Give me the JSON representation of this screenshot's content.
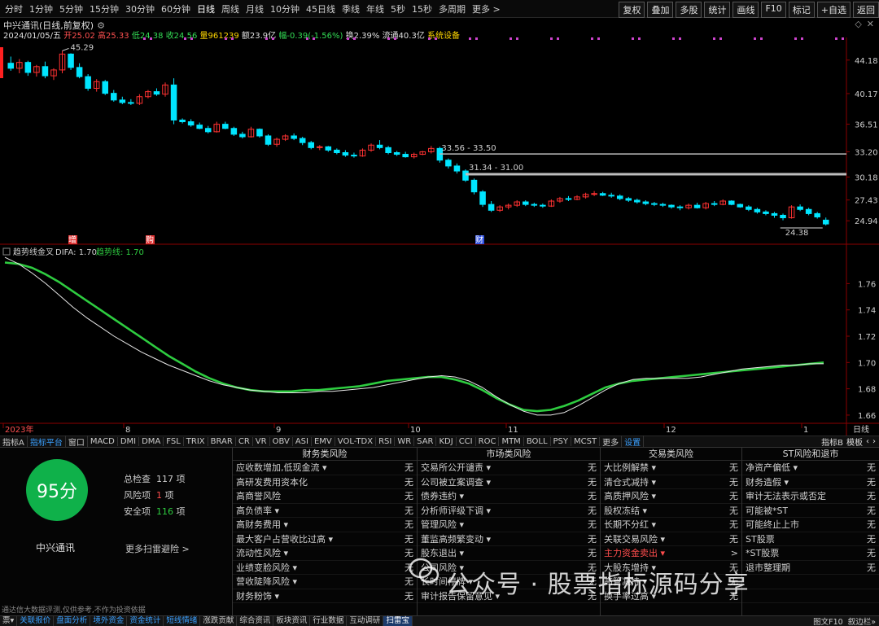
{
  "periods": [
    "分时",
    "1分钟",
    "5分钟",
    "15分钟",
    "30分钟",
    "60分钟",
    "日线",
    "周线",
    "月线",
    "10分钟",
    "45日线",
    "季线",
    "年线",
    "5秒",
    "15秒",
    "多周期",
    "更多 >"
  ],
  "active_period": "日线",
  "right_buttons": [
    "复权",
    "叠加",
    "多股",
    "统计",
    "画线",
    "F10",
    "标记",
    "+自选",
    "返回"
  ],
  "chart_title": "中兴通讯(日线,前复权)",
  "info": {
    "date": "2024/01/05/五",
    "open": "开25.02",
    "high": "高25.33",
    "low": "低24.38",
    "close": "收24.56",
    "volume": "量961239",
    "amount": "额23.9亿",
    "change": "幅-0.39(-1.56%)",
    "turnover": "换2.39%",
    "float": "流通40.3亿",
    "settings": "系统设备"
  },
  "window_controls": [
    "◇",
    "✕"
  ],
  "price_axis": [
    "44.18",
    "40.17",
    "36.51",
    "33.20",
    "30.18",
    "27.43",
    "24.94"
  ],
  "indicator_axis": [
    "1.76",
    "1.74",
    "1.72",
    "1.70",
    "1.68",
    "1.66"
  ],
  "date_labels": [
    "2023年",
    "8",
    "9",
    "10",
    "11",
    "12",
    "1"
  ],
  "date_right": "日线",
  "annotations": {
    "high": "45.29",
    "low": "24.38",
    "level1": "33.56 - 33.50",
    "level2": "31.34 - 31.00",
    "marker_a": "增",
    "marker_b": "购",
    "marker_c": "财"
  },
  "indicator": {
    "name": "趋势线金叉",
    "difa": "DIFA: 1.70",
    "trend": "趋势线: 1.70"
  },
  "indicator_tabs": [
    "指标A",
    "指标平台",
    "窗口",
    "MACD",
    "DMI",
    "DMA",
    "FSL",
    "TRIX",
    "BRAR",
    "CR",
    "VR",
    "OBV",
    "ASI",
    "EMV",
    "VOL-TDX",
    "RSI",
    "WR",
    "SAR",
    "KDJ",
    "CCI",
    "ROC",
    "MTM",
    "BOLL",
    "PSY",
    "MCST",
    "更多",
    "设置"
  ],
  "indicator_tabs_right": [
    "指标B",
    "模板",
    "‹",
    "›"
  ],
  "score": {
    "value": "95分",
    "company": "中兴通讯",
    "total_label": "总检查",
    "total": "117",
    "risk_label": "风险项",
    "risk": "1",
    "safe_label": "安全项",
    "safe": "116",
    "unit": "项",
    "more": "更多扫雷避险 >",
    "disclaimer": "通达信大数据评测,仅供参考,不作为投资依据"
  },
  "columns": [
    {
      "title": "财务类风险",
      "rows": [
        {
          "name": "应收数增加,低现金流 ▾",
          "value": "无"
        },
        {
          "name": "高研发费用资本化",
          "value": "无"
        },
        {
          "name": "高商誉风险",
          "value": "无"
        },
        {
          "name": "高负债率 ▾",
          "value": "无"
        },
        {
          "name": "高财务费用 ▾",
          "value": "无"
        },
        {
          "name": "最大客户占营收比过高 ▾",
          "value": "无"
        },
        {
          "name": "流动性风险 ▾",
          "value": "无"
        },
        {
          "name": "业绩变脸风险 ▾",
          "value": "无"
        },
        {
          "name": "营收陡降风险 ▾",
          "value": "无"
        },
        {
          "name": "财务粉饰 ▾",
          "value": "无"
        }
      ]
    },
    {
      "title": "市场类风险",
      "rows": [
        {
          "name": "交易所公开谴责 ▾",
          "value": "无"
        },
        {
          "name": "公司被立案调查 ▾",
          "value": "无"
        },
        {
          "name": "债券违约 ▾",
          "value": "无"
        },
        {
          "name": "分析师评级下调 ▾",
          "value": "无"
        },
        {
          "name": "管理风险 ▾",
          "value": "无"
        },
        {
          "name": "董监高频繁变动 ▾",
          "value": "无"
        },
        {
          "name": "股东退出 ▾",
          "value": "无"
        },
        {
          "name": "公司风险 ▾",
          "value": "无"
        },
        {
          "name": "长时间停牌 ▾",
          "value": "无"
        },
        {
          "name": "审计报告保留意见 ▾",
          "value": "无"
        }
      ]
    },
    {
      "title": "交易类风险",
      "rows": [
        {
          "name": "大比例解禁 ▾",
          "value": "无"
        },
        {
          "name": "清仓式减持 ▾",
          "value": "无"
        },
        {
          "name": "高质押风险 ▾",
          "value": "无"
        },
        {
          "name": "股权冻结 ▾",
          "value": "无"
        },
        {
          "name": "长期不分红 ▾",
          "value": "无"
        },
        {
          "name": "关联交易风险 ▾",
          "value": "无"
        },
        {
          "name": "主力资金卖出 ▾",
          "value": ">",
          "red": true
        },
        {
          "name": "大股东增持 ▾",
          "value": "无"
        },
        {
          "name": "高管减持 ▾",
          "value": "无"
        },
        {
          "name": "换手率过高 ▾",
          "value": "无"
        }
      ]
    },
    {
      "title": "ST风险和退市",
      "rows": [
        {
          "name": "净资产偏低 ▾",
          "value": "无"
        },
        {
          "name": "财务造假 ▾",
          "value": "无"
        },
        {
          "name": "审计无法表示或否定",
          "value": "无"
        },
        {
          "name": "可能被*ST",
          "value": "无"
        },
        {
          "name": "可能终止上市",
          "value": "无"
        },
        {
          "name": "ST股票",
          "value": "无"
        },
        {
          "name": "*ST股票",
          "value": "无"
        },
        {
          "name": "退市整理期",
          "value": "无"
        },
        {
          "name": "",
          "value": ""
        },
        {
          "name": "",
          "value": ""
        }
      ]
    }
  ],
  "watermark": "公众号 · 股票指标源码分享",
  "taskbar": [
    "票▾",
    "关联报价",
    "盘面分析",
    "境外资金",
    "资金统计",
    "短线情绪",
    "涨跌贡献",
    "综合资讯",
    "板块资讯",
    "行业数据",
    "互动调研",
    "扫雷宝"
  ],
  "taskbar_selected": "扫雷宝",
  "taskbar_right": [
    "图文F10",
    "叙边栏»"
  ],
  "colors": {
    "up": "#ff3232",
    "down": "#00e5ff",
    "ma_white": "#e6e6e6",
    "trend_green": "#2ecc40",
    "score_green": "#0fb14a",
    "purple_marks": "#cc44cc"
  },
  "chart_data": {
    "type": "candlestick",
    "ylim": [
      23.5,
      46.5
    ],
    "candles": [
      [
        43.8,
        44.6,
        42.9,
        43.2
      ],
      [
        43.2,
        44.3,
        42.6,
        43.9
      ],
      [
        43.9,
        44.1,
        42.3,
        42.7
      ],
      [
        42.7,
        43.6,
        42.2,
        43.4
      ],
      [
        43.4,
        44.0,
        42.0,
        42.3
      ],
      [
        42.3,
        43.2,
        41.8,
        43.0
      ],
      [
        43.0,
        45.29,
        42.6,
        44.9
      ],
      [
        44.9,
        45.0,
        43.0,
        43.3
      ],
      [
        43.3,
        43.8,
        42.0,
        42.2
      ],
      [
        42.2,
        42.5,
        40.5,
        40.8
      ],
      [
        40.8,
        41.9,
        40.4,
        41.6
      ],
      [
        41.6,
        41.8,
        40.0,
        40.2
      ],
      [
        40.2,
        40.6,
        39.2,
        39.4
      ],
      [
        39.4,
        39.8,
        38.9,
        39.1
      ],
      [
        39.1,
        39.5,
        38.8,
        39.0
      ],
      [
        39.0,
        40.1,
        38.8,
        39.8
      ],
      [
        39.8,
        40.6,
        39.6,
        40.4
      ],
      [
        40.4,
        40.8,
        39.9,
        40.1
      ],
      [
        40.1,
        41.5,
        39.8,
        41.2
      ],
      [
        41.2,
        42.0,
        36.5,
        37.0
      ],
      [
        37.0,
        37.2,
        36.6,
        36.8
      ],
      [
        36.8,
        37.1,
        36.2,
        36.4
      ],
      [
        36.4,
        36.7,
        35.9,
        36.0
      ],
      [
        36.0,
        36.3,
        35.4,
        35.6
      ],
      [
        35.6,
        36.8,
        35.5,
        36.5
      ],
      [
        36.5,
        36.8,
        35.9,
        36.0
      ],
      [
        36.0,
        36.2,
        35.1,
        35.3
      ],
      [
        35.3,
        35.6,
        34.8,
        35.0
      ],
      [
        35.0,
        36.2,
        34.9,
        35.9
      ],
      [
        35.9,
        36.0,
        34.9,
        35.1
      ],
      [
        35.1,
        35.3,
        33.9,
        34.1
      ],
      [
        34.1,
        34.9,
        33.8,
        34.7
      ],
      [
        34.7,
        35.3,
        34.5,
        35.1
      ],
      [
        35.1,
        35.4,
        34.6,
        34.8
      ],
      [
        34.8,
        35.0,
        34.0,
        34.3
      ],
      [
        34.3,
        34.5,
        33.5,
        33.7
      ],
      [
        33.7,
        34.0,
        33.4,
        33.8
      ],
      [
        33.8,
        33.9,
        33.2,
        33.4
      ],
      [
        33.4,
        33.6,
        32.9,
        33.1
      ],
      [
        33.1,
        33.4,
        32.6,
        32.8
      ],
      [
        32.8,
        33.1,
        32.5,
        32.7
      ],
      [
        32.7,
        33.6,
        32.6,
        33.4
      ],
      [
        33.4,
        34.2,
        33.2,
        34.0
      ],
      [
        34.0,
        34.6,
        33.5,
        33.7
      ],
      [
        33.7,
        33.9,
        32.9,
        33.1
      ],
      [
        33.1,
        33.3,
        32.7,
        32.9
      ],
      [
        32.9,
        33.2,
        32.5,
        32.6
      ],
      [
        32.6,
        33.1,
        32.4,
        32.9
      ],
      [
        32.9,
        33.3,
        32.8,
        33.2
      ],
      [
        33.2,
        33.9,
        33.0,
        33.6
      ],
      [
        33.6,
        33.8,
        31.9,
        32.2
      ],
      [
        32.2,
        32.4,
        31.2,
        31.5
      ],
      [
        31.5,
        31.8,
        30.6,
        30.9
      ],
      [
        30.9,
        31.1,
        29.6,
        29.8
      ],
      [
        29.8,
        30.0,
        28.1,
        28.4
      ],
      [
        28.4,
        28.6,
        26.6,
        26.9
      ],
      [
        26.9,
        27.3,
        26.0,
        26.2
      ],
      [
        26.2,
        26.8,
        26.0,
        26.6
      ],
      [
        26.6,
        27.0,
        26.3,
        26.8
      ],
      [
        26.8,
        27.4,
        26.6,
        27.2
      ],
      [
        27.2,
        27.4,
        26.7,
        26.9
      ],
      [
        26.9,
        27.1,
        26.6,
        26.8
      ],
      [
        26.8,
        27.0,
        26.5,
        26.7
      ],
      [
        26.7,
        27.5,
        26.6,
        27.3
      ],
      [
        27.3,
        27.8,
        27.1,
        27.6
      ],
      [
        27.6,
        27.9,
        27.3,
        27.5
      ],
      [
        27.5,
        28.0,
        27.4,
        27.8
      ],
      [
        27.8,
        28.3,
        27.6,
        28.1
      ],
      [
        28.1,
        28.5,
        27.9,
        28.2
      ],
      [
        28.2,
        28.4,
        27.9,
        28.0
      ],
      [
        28.0,
        28.3,
        27.7,
        27.9
      ],
      [
        27.9,
        28.1,
        27.4,
        27.6
      ],
      [
        27.6,
        27.8,
        27.2,
        27.4
      ],
      [
        27.4,
        27.6,
        27.0,
        27.2
      ],
      [
        27.2,
        27.4,
        26.8,
        27.0
      ],
      [
        27.0,
        27.2,
        26.7,
        26.9
      ],
      [
        26.9,
        27.1,
        26.6,
        26.8
      ],
      [
        26.8,
        26.9,
        26.4,
        26.6
      ],
      [
        26.6,
        26.8,
        26.2,
        26.5
      ],
      [
        26.5,
        27.0,
        26.3,
        26.8
      ],
      [
        26.8,
        27.1,
        26.4,
        26.5
      ],
      [
        26.5,
        27.2,
        26.3,
        27.0
      ],
      [
        27.0,
        27.3,
        26.7,
        26.9
      ],
      [
        26.9,
        27.5,
        26.8,
        27.3
      ],
      [
        27.3,
        27.4,
        26.8,
        26.9
      ],
      [
        26.9,
        27.0,
        26.5,
        26.6
      ],
      [
        26.6,
        26.8,
        26.1,
        26.3
      ],
      [
        26.3,
        26.5,
        25.8,
        26.0
      ],
      [
        26.0,
        26.2,
        25.6,
        25.8
      ],
      [
        25.8,
        26.0,
        25.3,
        25.6
      ],
      [
        25.6,
        25.8,
        25.0,
        25.3
      ],
      [
        25.3,
        26.8,
        25.2,
        26.6
      ],
      [
        26.6,
        26.9,
        26.1,
        26.3
      ],
      [
        26.3,
        26.5,
        25.6,
        25.8
      ],
      [
        25.8,
        26.0,
        25.2,
        25.4
      ],
      [
        25.02,
        25.33,
        24.38,
        24.56
      ]
    ],
    "indicator": {
      "ylim": [
        1.655,
        1.785
      ],
      "difa": [
        1.78,
        1.775,
        1.768,
        1.76,
        1.751,
        1.742,
        1.734,
        1.727,
        1.72,
        1.714,
        1.708,
        1.703,
        1.698,
        1.694,
        1.69,
        1.686,
        1.683,
        1.681,
        1.679,
        1.678,
        1.677,
        1.677,
        1.677,
        1.678,
        1.678,
        1.679,
        1.68,
        1.681,
        1.683,
        1.685,
        1.687,
        1.689,
        1.69,
        1.689,
        1.686,
        1.681,
        1.674,
        1.668,
        1.663,
        1.66,
        1.66,
        1.662,
        1.667,
        1.673,
        1.679,
        1.684,
        1.687,
        1.688,
        1.688,
        1.688,
        1.688,
        1.689,
        1.691,
        1.693,
        1.695,
        1.696,
        1.697,
        1.698,
        1.698,
        1.699,
        1.699
      ],
      "trend": [
        1.776,
        1.775,
        1.772,
        1.767,
        1.761,
        1.754,
        1.747,
        1.74,
        1.733,
        1.726,
        1.719,
        1.712,
        1.705,
        1.699,
        1.693,
        1.688,
        1.684,
        1.681,
        1.679,
        1.678,
        1.678,
        1.678,
        1.679,
        1.679,
        1.68,
        1.681,
        1.682,
        1.684,
        1.686,
        1.687,
        1.688,
        1.689,
        1.689,
        1.687,
        1.684,
        1.679,
        1.673,
        1.668,
        1.664,
        1.663,
        1.664,
        1.667,
        1.671,
        1.676,
        1.681,
        1.684,
        1.686,
        1.687,
        1.688,
        1.689,
        1.69,
        1.691,
        1.692,
        1.693,
        1.694,
        1.695,
        1.696,
        1.697,
        1.698,
        1.699,
        1.7
      ]
    }
  }
}
